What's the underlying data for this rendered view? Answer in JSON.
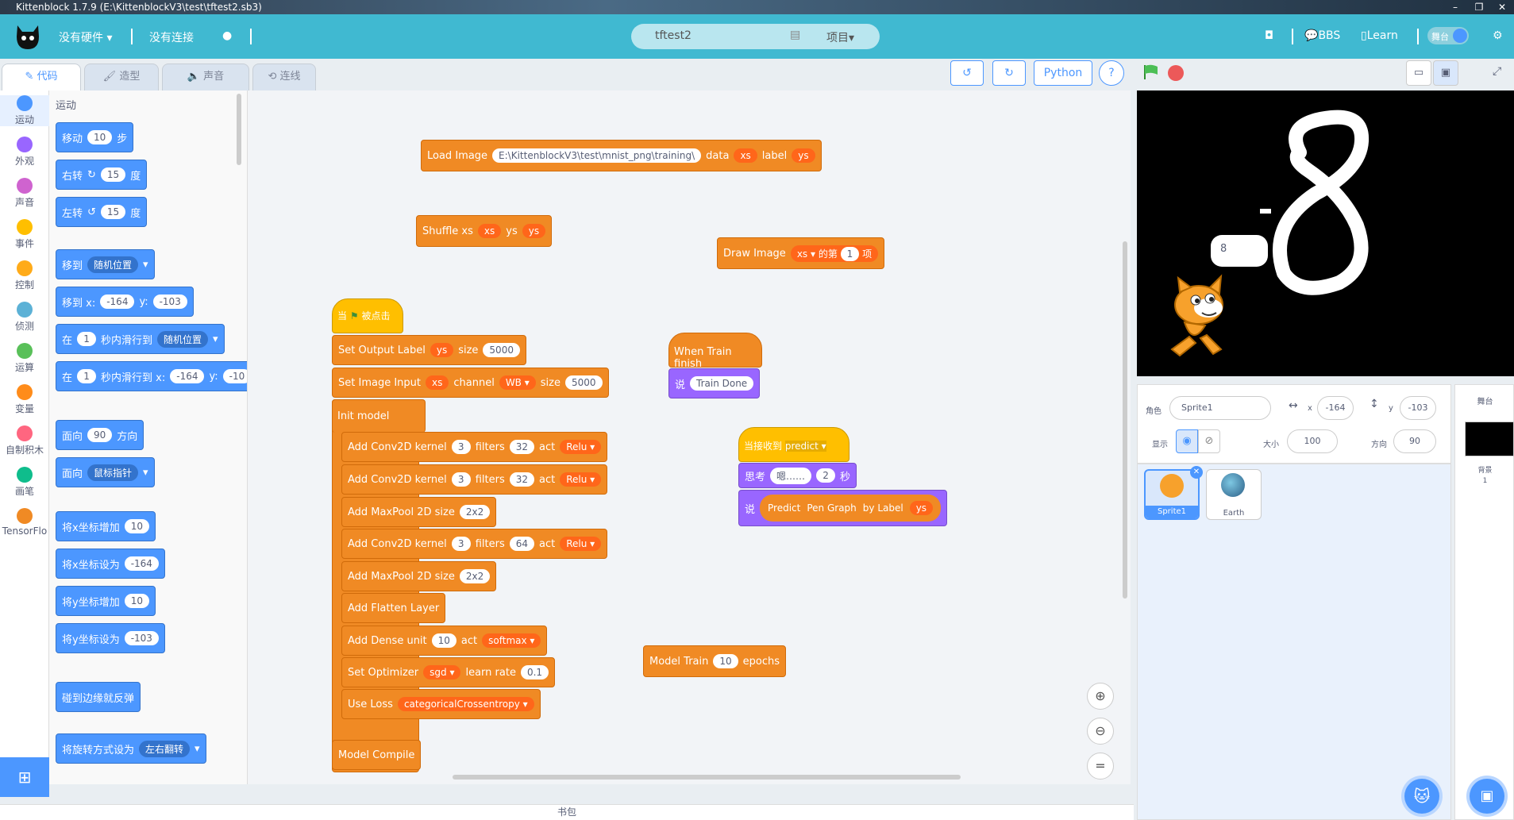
{
  "window": {
    "title": "Kittenblock 1.7.9 (E:\\KittenblockV3\\test\\tftest2.sb3)"
  },
  "topbar": {
    "hardware": "没有硬件 ▾",
    "connection": "没有连接",
    "project_name": "tftest2",
    "project_menu": "项目▾",
    "bbs": "BBS",
    "learn": "Learn",
    "stage_toggle": "舞台"
  },
  "tabs": {
    "code": "代码",
    "costume": "造型",
    "sound": "声音",
    "wire": "连线"
  },
  "toolbar": {
    "python": "Python",
    "help": "?"
  },
  "categories": [
    "运动",
    "外观",
    "声音",
    "事件",
    "控制",
    "侦测",
    "运算",
    "变量",
    "自制积木",
    "画笔",
    "TensorFlo"
  ],
  "category_colors": [
    "#4c97ff",
    "#9966ff",
    "#cf63cf",
    "#ffbf00",
    "#ffab19",
    "#5cb1d6",
    "#59c059",
    "#ff8c1a",
    "#ff6680",
    "#0fbd8c",
    "#f08a24"
  ],
  "palette": {
    "heading": "运动",
    "move": "移动",
    "move_steps": "10",
    "steps": "步",
    "turn_right": "右转",
    "turn_right_deg": "15",
    "degrees": "度",
    "turn_left": "左转",
    "turn_left_deg": "15",
    "goto": "移到",
    "goto_target": "随机位置",
    "goto_xy": "移到 x:",
    "x_val": "-164",
    "y_label": "y:",
    "y_val": "-103",
    "glide_in": "在",
    "glide_secs": "1",
    "glide_to": "秒内滑行到",
    "glide_target": "随机位置",
    "glide_xy": "秒内滑行到 x:",
    "glide_x": "-164",
    "glide_y": "-10",
    "point_dir": "面向",
    "dir_val": "90",
    "dir_word": "方向",
    "point_to": "面向",
    "point_target": "鼠标指针",
    "change_x": "将x坐标增加",
    "change_x_val": "10",
    "set_x": "将x坐标设为",
    "set_x_val": "-164",
    "change_y": "将y坐标增加",
    "change_y_val": "10",
    "set_y": "将y坐标设为",
    "set_y_val": "-103",
    "bounce": "碰到边缘就反弹",
    "rotation": "将旋转方式设为",
    "rotation_val": "左右翻转"
  },
  "workspace": {
    "load_image": "Load Image",
    "load_path": "E:\\KittenblockV3\\test\\mnist_png\\training\\",
    "data": "data",
    "xs": "xs",
    "label": "label",
    "ys": "ys",
    "shuffle": "Shuffle xs",
    "shuffle_ys": "ys",
    "draw_image": "Draw Image",
    "draw_of": "的第",
    "draw_idx": "1",
    "draw_item": "项",
    "hat_when": "当",
    "hat_clicked": "被点击",
    "set_output": "Set Output Label",
    "size": "size",
    "output_size": "5000",
    "set_input": "Set Image Input",
    "channel": "channel",
    "channel_val": "WB",
    "input_size": "5000",
    "init_model": "Init model",
    "conv1": "Add Conv2D kernel",
    "kernel1": "3",
    "filters": "filters",
    "filters1": "32",
    "act": "act",
    "relu": "Relu",
    "kernel2": "3",
    "filters2": "32",
    "maxpool": "Add MaxPool 2D size",
    "pool1": "2x2",
    "kernel3": "3",
    "filters3": "64",
    "pool2": "2x2",
    "flatten": "Add Flatten Layer",
    "dense": "Add Dense unit",
    "dense_units": "10",
    "softmax": "softmax",
    "optimizer": "Set Optimizer",
    "sgd": "sgd",
    "learn_rate": "learn rate",
    "lr_val": "0.1",
    "use_loss": "Use Loss",
    "loss_val": "categoricalCrossentropy",
    "compile": "Model Compile",
    "when_train": "When Train finish",
    "say": "说",
    "train_done": "Train Done",
    "when_receive": "当接收到",
    "predict_msg": "predict",
    "think": "思考",
    "think_text": "嗯……",
    "think_secs": "2",
    "secs": "秒",
    "predict": "Predict",
    "pen_graph": "Pen Graph",
    "by_label": "by Label",
    "model_train": "Model Train",
    "epochs_val": "10",
    "epochs": "epochs"
  },
  "stage": {
    "bubble": "8",
    "digit": "8"
  },
  "sprite_info": {
    "sprite_label": "角色",
    "sprite_name": "Sprite1",
    "x_label": "x",
    "x": "-164",
    "y_label": "y",
    "y": "-103",
    "show_label": "显示",
    "size_label": "大小",
    "size": "100",
    "dir_label": "方向",
    "direction": "90"
  },
  "sprites": [
    "Sprite1",
    "Earth"
  ],
  "stage_panel": {
    "title": "舞台",
    "backdrops_label": "背景",
    "backdrops_count": "1"
  },
  "bottom": {
    "backpack": "书包"
  }
}
